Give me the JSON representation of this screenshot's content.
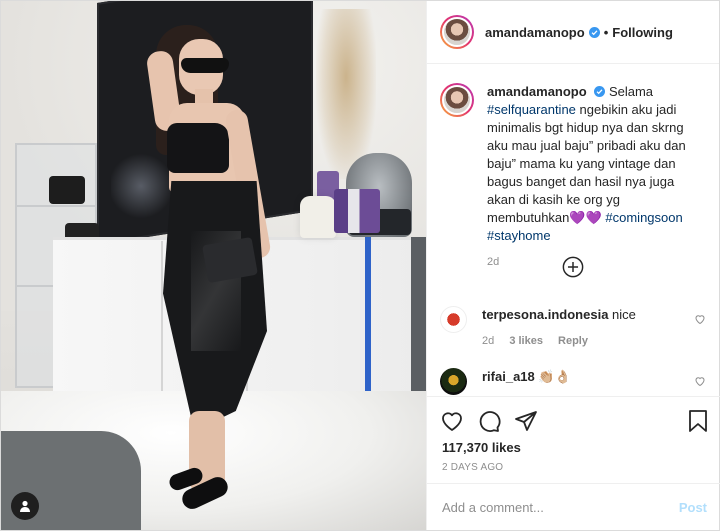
{
  "post": {
    "username": "amandamanopo",
    "follow_state": "Following",
    "dot": "•"
  },
  "caption": {
    "username": "amandamanopo",
    "text_1": "Selama",
    "hashtag_1": "#selfquarantine",
    "text_2": " ngebikin aku jadi minimalis bgt hidup nya dan skrng aku mau jual baju” pribadi aku dan baju” mama ku yang vintage dan bagus banget dan hasil nya juga akan di kasih ke org yg membutuhkan💜💜",
    "hashtag_2": "#comingsoon",
    "hashtag_3": "#stayhome",
    "age": "2d"
  },
  "comments": [
    {
      "username": "terpesona.indonesia",
      "text": "nice",
      "age": "2d",
      "likes": "3 likes",
      "reply": "Reply"
    },
    {
      "username": "rifai_a18",
      "text": "👏🏼👌🏼",
      "age": "",
      "likes": "",
      "reply": ""
    }
  ],
  "stats": {
    "likes": "117,370 likes",
    "date": "2 DAYS AGO"
  },
  "comment_box": {
    "placeholder": "Add a comment...",
    "post_label": "Post"
  },
  "icons": {
    "verified": "verified-badge-icon",
    "like": "heart-icon",
    "comment": "comment-icon",
    "share": "paper-plane-icon",
    "save": "bookmark-icon",
    "load_more": "plus-circle-icon",
    "tags": "user-tag-icon"
  },
  "colors": {
    "hashtag": "#00376b",
    "verified": "#3897f0",
    "post_disabled": "#b2dffc",
    "muted": "#8e8e8e"
  }
}
